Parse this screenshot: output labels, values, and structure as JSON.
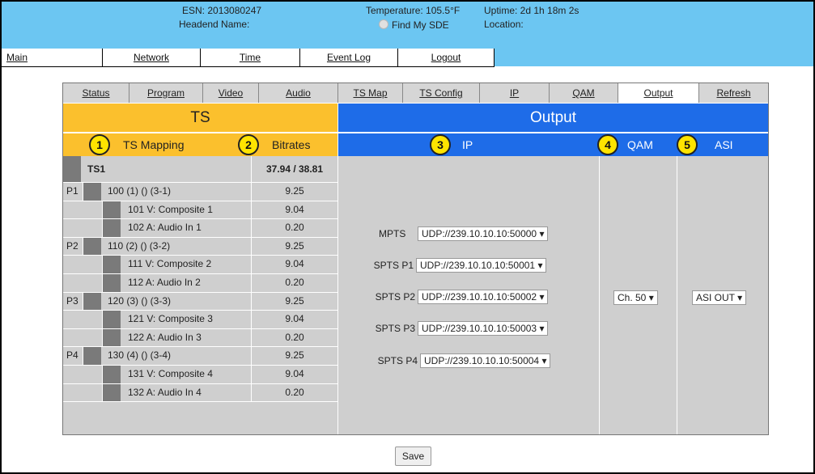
{
  "header": {
    "esn": "ESN: 2013080247",
    "headend_name": "Headend Name:",
    "temperature": "Temperature: 105.5°F",
    "find_my_sde": "Find My SDE",
    "uptime": "Uptime: 2d 1h 18m 2s",
    "location": "Location:"
  },
  "topnav": [
    "Main",
    "Network",
    "Time",
    "Event Log",
    "Logout"
  ],
  "subnav": [
    "Status",
    "Program",
    "Video",
    "Audio",
    "TS Map",
    "TS Config",
    "IP",
    "QAM",
    "Output",
    "Refresh"
  ],
  "ts": {
    "title": "TS",
    "mapping_badge": "1",
    "mapping_label": "TS Mapping",
    "bitrates_badge": "2",
    "bitrates_label": "Bitrates",
    "rows": [
      {
        "p": "",
        "name": "TS1",
        "rate": "37.94 / 38.81",
        "level": 0
      },
      {
        "p": "P1",
        "name": "100 (1) () (3-1)",
        "rate": "9.25",
        "level": 1
      },
      {
        "p": "",
        "name": "101 V: Composite 1",
        "rate": "9.04",
        "level": 2
      },
      {
        "p": "",
        "name": "102 A: Audio In 1",
        "rate": "0.20",
        "level": 2
      },
      {
        "p": "P2",
        "name": "110 (2) () (3-2)",
        "rate": "9.25",
        "level": 1
      },
      {
        "p": "",
        "name": "111 V: Composite 2",
        "rate": "9.04",
        "level": 2
      },
      {
        "p": "",
        "name": "112 A: Audio In 2",
        "rate": "0.20",
        "level": 2
      },
      {
        "p": "P3",
        "name": "120 (3) () (3-3)",
        "rate": "9.25",
        "level": 1
      },
      {
        "p": "",
        "name": "121 V: Composite 3",
        "rate": "9.04",
        "level": 2
      },
      {
        "p": "",
        "name": "122 A: Audio In 3",
        "rate": "0.20",
        "level": 2
      },
      {
        "p": "P4",
        "name": "130 (4) () (3-4)",
        "rate": "9.25",
        "level": 1
      },
      {
        "p": "",
        "name": "131 V: Composite 4",
        "rate": "9.04",
        "level": 2
      },
      {
        "p": "",
        "name": "132 A: Audio In 4",
        "rate": "0.20",
        "level": 2
      }
    ]
  },
  "output": {
    "title": "Output",
    "ip_badge": "3",
    "ip_label": "IP",
    "qam_badge": "4",
    "qam_label": "QAM",
    "asi_badge": "5",
    "asi_label": "ASI",
    "ip_rows": [
      {
        "label": "MPTS",
        "value": "UDP://239.10.10.10:50000 ▾"
      },
      {
        "label": "SPTS P1",
        "value": "UDP://239.10.10.10:50001 ▾"
      },
      {
        "label": "SPTS P2",
        "value": "UDP://239.10.10.10:50002 ▾"
      },
      {
        "label": "SPTS P3",
        "value": "UDP://239.10.10.10:50003 ▾"
      },
      {
        "label": "SPTS P4",
        "value": "UDP://239.10.10.10:50004 ▾"
      }
    ],
    "qam_value": "Ch. 50 ▾",
    "asi_value": "ASI OUT ▾"
  },
  "save_label": "Save",
  "colors": {
    "header_blue": "#6cc6f2",
    "ts_yellow": "#fbc02d",
    "output_blue": "#1e6ce8",
    "badge_yellow": "#ffe400"
  }
}
